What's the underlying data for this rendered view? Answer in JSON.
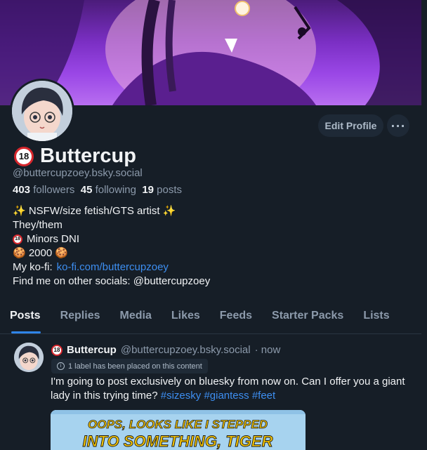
{
  "profile": {
    "display_name": "Buttercup",
    "badge": "18",
    "handle": "@buttercupzoey.bsky.social",
    "stats": {
      "followers": "403",
      "followers_label": "followers",
      "following": "45",
      "following_label": "following",
      "posts": "19",
      "posts_label": "posts"
    }
  },
  "actions": {
    "edit_profile": "Edit Profile",
    "more": "···"
  },
  "bio": {
    "line1": "✨ NSFW/size fetish/GTS artist ✨",
    "line2": "They/them",
    "line3": "Minors DNI",
    "line4": "🍪 2000 🍪",
    "line5_prefix": "My ko-fi: ",
    "line5_link": "ko-fi.com/buttercupzoey",
    "line6": "Find me on other socials: @buttercupzoey"
  },
  "tabs": [
    "Posts",
    "Replies",
    "Media",
    "Likes",
    "Feeds",
    "Starter Packs",
    "Lists"
  ],
  "active_tab": "Posts",
  "post": {
    "author": "Buttercup",
    "handle": "@buttercupzoey.bsky.social",
    "time": "· now",
    "label_notice": "1 label has been placed on this content",
    "text": "I'm going to post exclusively on bluesky from now on. Can I offer you a giant lady in this trying time? ",
    "tags": [
      "#sizesky",
      "#giantess",
      "#feet"
    ],
    "image_caption_line1": "OOPS, LOOKS LIKE I STEPPED",
    "image_caption_line2": "INTO SOMETHING, TIGER"
  },
  "colors": {
    "background": "#161e27",
    "accent": "#2f84e8",
    "link": "#3d8ef0",
    "muted": "#8c9aab"
  }
}
